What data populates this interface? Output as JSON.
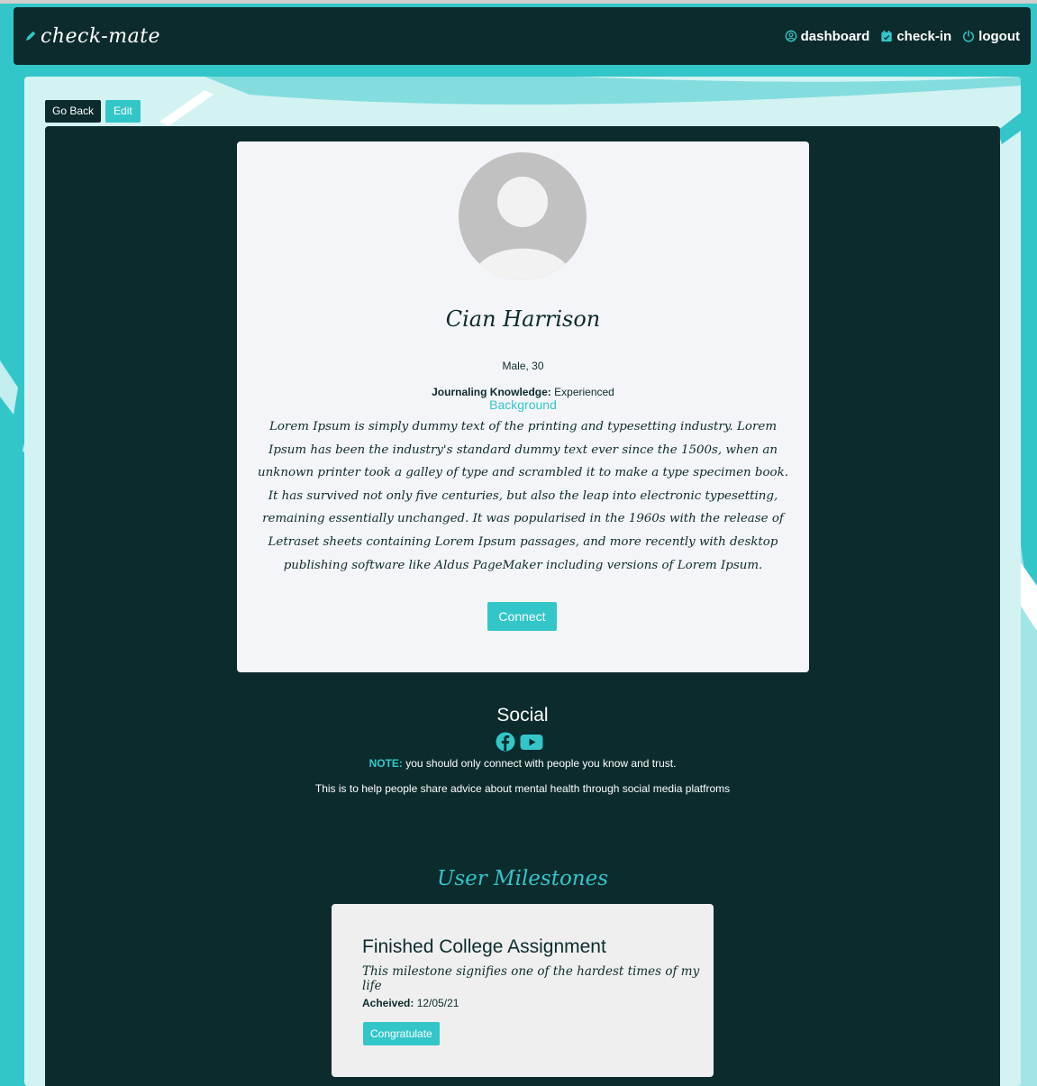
{
  "nav": {
    "brand": "check-mate",
    "links": [
      {
        "label": "dashboard",
        "icon": "user-circle-icon"
      },
      {
        "label": "check-in",
        "icon": "calendar-check-icon"
      },
      {
        "label": "logout",
        "icon": "power-icon"
      }
    ]
  },
  "actions": {
    "go_back": "Go Back",
    "edit": "Edit"
  },
  "profile": {
    "name": "Cian Harrison",
    "meta": "Male, 30",
    "knowledge_label": "Journaling Knowledge:",
    "knowledge_value": "Experienced",
    "background_heading": "Background",
    "background_text": "Lorem Ipsum is simply dummy text of the printing and typesetting industry. Lorem Ipsum has been the industry's standard dummy text ever since the 1500s, when an unknown printer took a galley of type and scrambled it to make a type specimen book. It has survived not only five centuries, but also the leap into electronic typesetting, remaining essentially unchanged. It was popularised in the 1960s with the release of Letraset sheets containing Lorem Ipsum passages, and more recently with desktop publishing software like Aldus PageMaker including versions of Lorem Ipsum.",
    "connect_label": "Connect"
  },
  "social": {
    "title": "Social",
    "icons": [
      "facebook-icon",
      "youtube-icon"
    ],
    "note_label": "NOTE:",
    "note_text": " you should only connect with people you know and trust.",
    "help_text": "This is to help people share advice about mental health through social media platfroms"
  },
  "milestones": {
    "title": "User Milestones",
    "items": [
      {
        "title": "Finished College Assignment",
        "description": "This milestone signifies one of the hardest times of my life",
        "achieved_label": "Acheived:",
        "achieved_date": "12/05/21",
        "congratulate_label": "Congratulate"
      }
    ]
  },
  "colors": {
    "dark": "#0c2b2d",
    "accent": "#33c6c9",
    "panel": "#d2f3f2",
    "card": "#f4f5f9"
  }
}
